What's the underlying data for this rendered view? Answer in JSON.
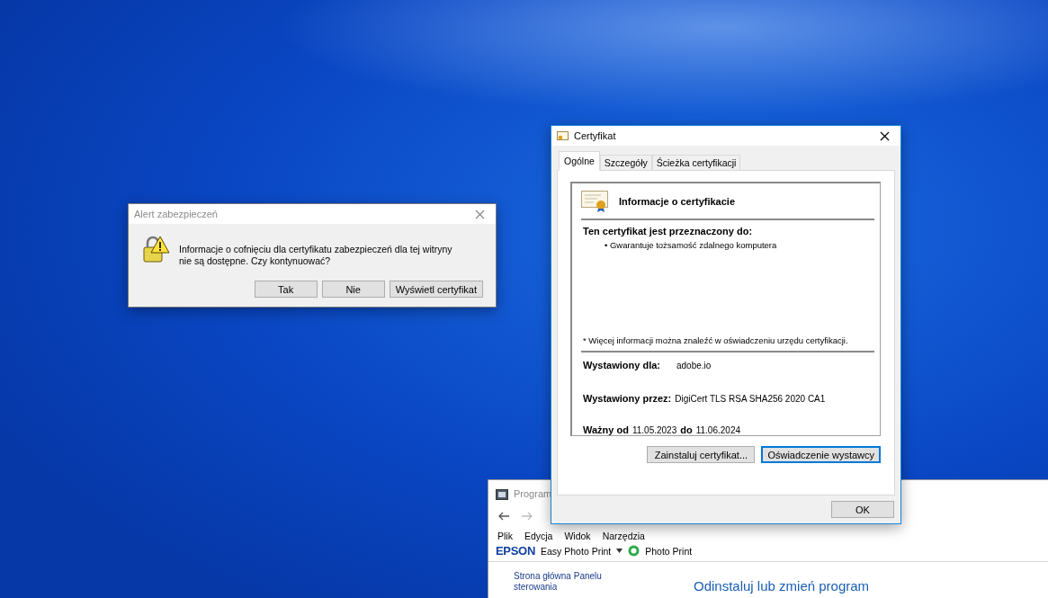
{
  "alert": {
    "title": "Alert zabezpieczeń",
    "message": "Informacje o cofnięciu dla certyfikatu zabezpieczeń dla tej witryny nie są dostępne. Czy kontynuować?",
    "buttons": [
      {
        "label": "Tak"
      },
      {
        "label": "Nie"
      },
      {
        "label": "Wyświetl certyfikat"
      }
    ]
  },
  "certificate": {
    "title": "Certyfikat",
    "tabs": [
      {
        "label": "Ogólne",
        "selected": true
      },
      {
        "label": "Szczegóły",
        "selected": false
      },
      {
        "label": "Ścieżka certyfikacji",
        "selected": false
      }
    ],
    "heading": "Informacje o certyfikacie",
    "purpose_title": "Ten certyfikat jest przeznaczony do:",
    "purposes": [
      "• Gwarantuje tożsamość zdalnego komputera"
    ],
    "note": "* Więcej informacji można znaleźć w oświadczeniu urzędu certyfikacji.",
    "issued_to": {
      "label": "Wystawiony dla:",
      "value": "adobe.io"
    },
    "issued_by": {
      "label": "Wystawiony przez:",
      "value": "DigiCert TLS RSA SHA256 2020 CA1"
    },
    "validity": {
      "from_label": "Ważny od",
      "from": "11.05.2023",
      "to_label": "do",
      "to": "11.06.2024"
    },
    "buttons": [
      {
        "label": "Zainstaluj certyfikat...",
        "focused": false
      },
      {
        "label": "Oświadczenie wystawcy",
        "focused": true
      }
    ],
    "ok": "OK"
  },
  "programs_window": {
    "title": "Program",
    "menu": [
      "Plik",
      "Edycja",
      "Widok",
      "Narzędzia"
    ],
    "brand": "EPSON",
    "toolbar_item": "Easy Photo Print",
    "toolbar_item_2": "Photo Print",
    "sidebar_link": "Strona główna Panelu sterowania",
    "heading": "Odinstaluj lub zmień program"
  }
}
